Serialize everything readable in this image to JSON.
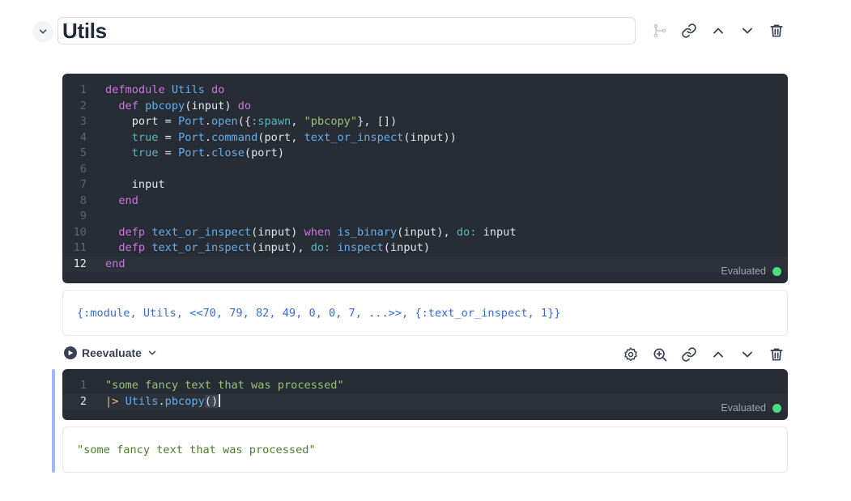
{
  "section": {
    "title": "Utils"
  },
  "cell1": {
    "line_numbers": [
      "1",
      "2",
      "3",
      "4",
      "5",
      "6",
      "7",
      "8",
      "9",
      "10",
      "11",
      "12"
    ],
    "status": "Evaluated",
    "status_color": "#4ade80"
  },
  "output1": {
    "text": "{:module, Utils, <<70, 79, 82, 49, 0, 0, 7, ...>>, {:text_or_inspect, 1}}"
  },
  "toolbar": {
    "reevaluate_label": "Reevaluate"
  },
  "cell2": {
    "line_numbers": [
      "1",
      "2"
    ],
    "status": "Evaluated"
  },
  "output2": {
    "text": "\"some fancy text that was processed\""
  },
  "icons": {
    "section_actions": [
      "branch-icon",
      "link-icon",
      "chevron-up-icon",
      "chevron-down-icon",
      "trash-icon"
    ],
    "cell_actions": [
      "settings-icon",
      "zoom-in-icon",
      "link-icon",
      "chevron-up-icon",
      "chevron-down-icon",
      "trash-icon"
    ]
  },
  "colors": {
    "editor_bg": "#282c34",
    "accent_rail": "#a5b4fc"
  }
}
